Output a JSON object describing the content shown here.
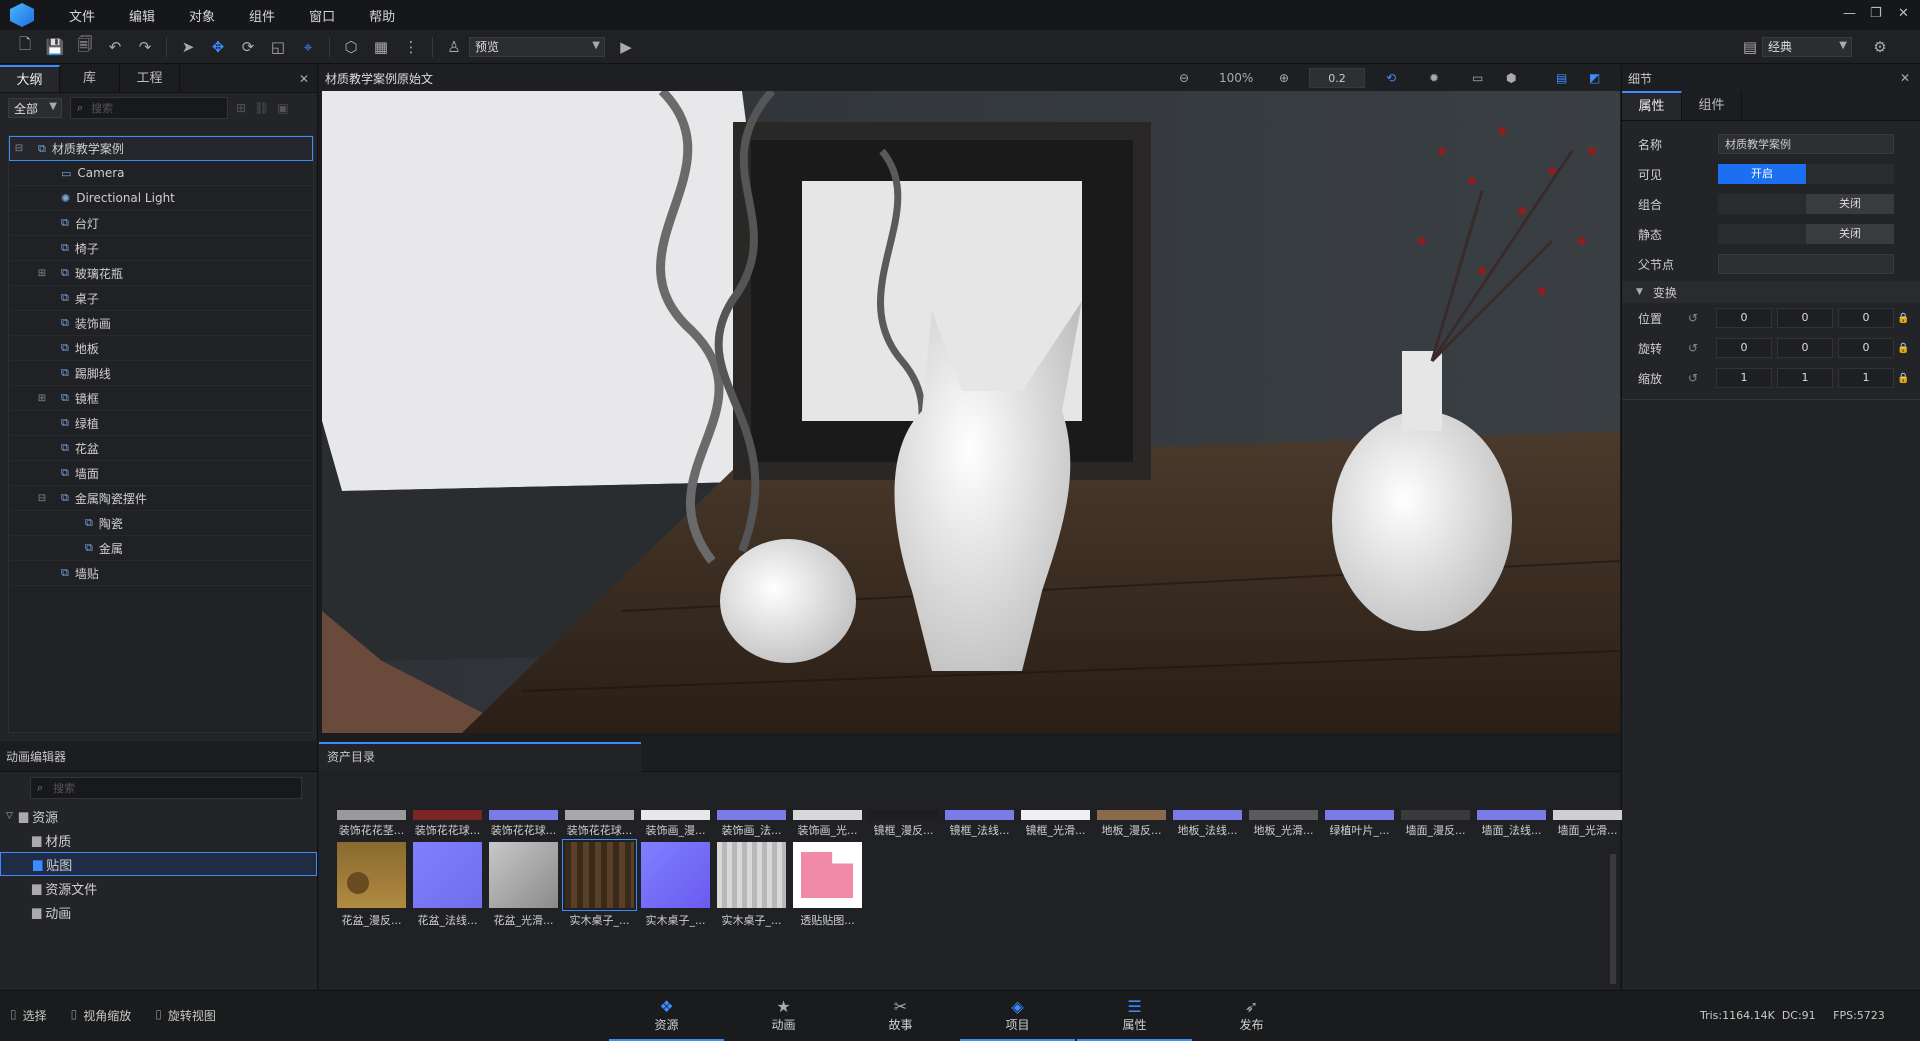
{
  "menu": {
    "items": [
      "文件",
      "编辑",
      "对象",
      "组件",
      "窗口",
      "帮助"
    ]
  },
  "toolbar": {
    "mode_select": "预览",
    "layout_select": "经典"
  },
  "left_panel": {
    "tabs": [
      "大纲",
      "库",
      "工程"
    ],
    "filter": "全部",
    "search_placeholder": "搜索",
    "tree": [
      {
        "label": "材质教学案例",
        "depth": 0,
        "expander": "⊟"
      },
      {
        "label": "Camera",
        "depth": 1,
        "icon": "camera"
      },
      {
        "label": "Directional Light",
        "depth": 1,
        "icon": "light"
      },
      {
        "label": "台灯",
        "depth": 1
      },
      {
        "label": "椅子",
        "depth": 1
      },
      {
        "label": "玻璃花瓶",
        "depth": 1,
        "expander": "⊞"
      },
      {
        "label": "桌子",
        "depth": 1
      },
      {
        "label": "装饰画",
        "depth": 1
      },
      {
        "label": "地板",
        "depth": 1
      },
      {
        "label": "踢脚线",
        "depth": 1
      },
      {
        "label": "镜框",
        "depth": 1,
        "expander": "⊞"
      },
      {
        "label": "绿植",
        "depth": 1
      },
      {
        "label": "花盆",
        "depth": 1
      },
      {
        "label": "墙面",
        "depth": 1
      },
      {
        "label": "金属陶瓷摆件",
        "depth": 1,
        "expander": "⊟"
      },
      {
        "label": "陶瓷",
        "depth": 2
      },
      {
        "label": "金属",
        "depth": 2
      },
      {
        "label": "墙贴",
        "depth": 1
      }
    ]
  },
  "viewport": {
    "title": "材质教学案例原始文",
    "zoom": "100%",
    "step": "0.2"
  },
  "right_panel": {
    "title": "细节",
    "tabs": [
      "属性",
      "组件"
    ],
    "name_label": "名称",
    "name_value": "材质教学案例",
    "visible_label": "可见",
    "visible_on": "开启",
    "group_label": "组合",
    "group_off": "关闭",
    "static_label": "静态",
    "static_off": "关闭",
    "parent_label": "父节点",
    "transform_header": "变换",
    "position_label": "位置",
    "position": [
      "0",
      "0",
      "0"
    ],
    "rotation_label": "旋转",
    "rotation": [
      "0",
      "0",
      "0"
    ],
    "scale_label": "缩放",
    "scale": [
      "1",
      "1",
      "1"
    ]
  },
  "anim_panel": {
    "title": "动画编辑器",
    "search_placeholder": "搜索",
    "tree": [
      {
        "label": "资源",
        "depth": 0
      },
      {
        "label": "材质",
        "depth": 1
      },
      {
        "label": "贴图",
        "depth": 1,
        "selected": true
      },
      {
        "label": "资源文件",
        "depth": 1
      },
      {
        "label": "动画",
        "depth": 1
      }
    ]
  },
  "assets": {
    "tab": "资产目录",
    "row1": [
      {
        "cap": "装饰花花茎...",
        "color": "#9a9a9a"
      },
      {
        "cap": "装饰花花球...",
        "color": "#7a2626"
      },
      {
        "cap": "装饰花花球...",
        "color": "#7b7be8"
      },
      {
        "cap": "装饰花花球...",
        "color": "#a8a8a8"
      },
      {
        "cap": "装饰画_漫...",
        "color": "#e8e8e8"
      },
      {
        "cap": "装饰画_法...",
        "color": "#7b7be8"
      },
      {
        "cap": "装饰画_光...",
        "color": "#d8d8d8"
      },
      {
        "cap": "镜框_漫反...",
        "color": "#1e1e1e"
      },
      {
        "cap": "镜框_法线...",
        "color": "#7b7be8"
      },
      {
        "cap": "镜框_光滑...",
        "color": "#f0f0f0"
      },
      {
        "cap": "地板_漫反...",
        "color": "#8a6a4a"
      },
      {
        "cap": "地板_法线...",
        "color": "#7b7be8"
      },
      {
        "cap": "地板_光滑...",
        "color": "#5a5a5a"
      },
      {
        "cap": "绿植叶片_...",
        "color": "#7b7be8"
      },
      {
        "cap": "墙面_漫反...",
        "color": "#3a3a3a"
      },
      {
        "cap": "墙面_法线...",
        "color": "#7b7be8"
      },
      {
        "cap": "墙面_光滑...",
        "color": "#d0d0d0"
      }
    ],
    "row2": [
      {
        "cap": "花盆_漫反...",
        "bg": "linear-gradient(180deg,#8a6a30,#b08a40)"
      },
      {
        "cap": "花盆_法线...",
        "bg": "linear-gradient(135deg,#8080ff,#6f6fee)"
      },
      {
        "cap": "花盆_光滑...",
        "bg": "linear-gradient(135deg,#c8c8c8,#8a8a8a)"
      },
      {
        "cap": "实木桌子_...",
        "bg": "repeating-linear-gradient(90deg,#3a2a1a 0 6px,#5a4028 6px 12px)"
      },
      {
        "cap": "实木桌子_...",
        "bg": "linear-gradient(135deg,#8080ff,#6a5af0)"
      },
      {
        "cap": "实木桌子_...",
        "bg": "repeating-linear-gradient(90deg,#d8d8d8 0 5px,#b8b8b8 5px 10px)"
      },
      {
        "cap": "透贴贴图...",
        "bg": "#ffffff"
      }
    ]
  },
  "footer": {
    "tools": [
      "选择",
      "视角缩放",
      "旋转视图"
    ],
    "tabs": [
      "资源",
      "动画",
      "故事",
      "项目",
      "属性",
      "发布"
    ],
    "stats": "Tris:1164.14K  DC:91     FPS:5723"
  }
}
